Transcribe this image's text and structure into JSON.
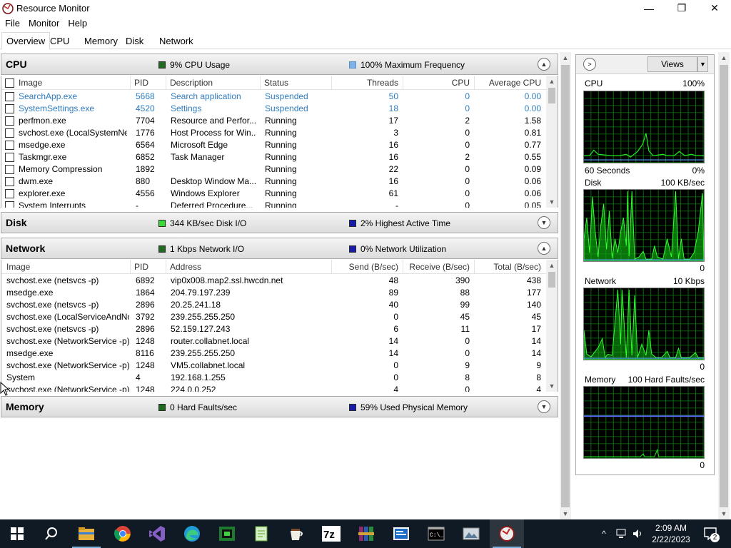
{
  "window": {
    "title": "Resource Monitor",
    "controls": [
      "—",
      "❐",
      "✕"
    ]
  },
  "menu": [
    "File",
    "Monitor",
    "Help"
  ],
  "tabs": [
    "Overview",
    "CPU",
    "Memory",
    "Disk",
    "Network"
  ],
  "cpu": {
    "title": "CPU",
    "usage_color": "#1d6d1d",
    "usage": "9% CPU Usage",
    "freq_color": "#7fb2ea",
    "freq": "100% Maximum Frequency",
    "columns": [
      "Image",
      "PID",
      "Description",
      "Status",
      "Threads",
      "CPU",
      "Average CPU"
    ],
    "rows": [
      {
        "image": "SearchApp.exe",
        "pid": "5668",
        "desc": "Search application",
        "status": "Suspended",
        "threads": "50",
        "cpu": "0",
        "avg": "0.00",
        "suspended": true
      },
      {
        "image": "SystemSettings.exe",
        "pid": "4520",
        "desc": "Settings",
        "status": "Suspended",
        "threads": "18",
        "cpu": "0",
        "avg": "0.00",
        "suspended": true
      },
      {
        "image": "perfmon.exe",
        "pid": "7704",
        "desc": "Resource and Perfor...",
        "status": "Running",
        "threads": "17",
        "cpu": "2",
        "avg": "1.58"
      },
      {
        "image": "svchost.exe (LocalSystemNet...",
        "pid": "1776",
        "desc": "Host Process for Win...",
        "status": "Running",
        "threads": "3",
        "cpu": "0",
        "avg": "0.81"
      },
      {
        "image": "msedge.exe",
        "pid": "6564",
        "desc": "Microsoft Edge",
        "status": "Running",
        "threads": "16",
        "cpu": "0",
        "avg": "0.77"
      },
      {
        "image": "Taskmgr.exe",
        "pid": "6852",
        "desc": "Task Manager",
        "status": "Running",
        "threads": "16",
        "cpu": "2",
        "avg": "0.55"
      },
      {
        "image": "Memory Compression",
        "pid": "1892",
        "desc": "",
        "status": "Running",
        "threads": "22",
        "cpu": "0",
        "avg": "0.09"
      },
      {
        "image": "dwm.exe",
        "pid": "880",
        "desc": "Desktop Window Ma...",
        "status": "Running",
        "threads": "16",
        "cpu": "0",
        "avg": "0.06"
      },
      {
        "image": "explorer.exe",
        "pid": "4556",
        "desc": "Windows Explorer",
        "status": "Running",
        "threads": "61",
        "cpu": "0",
        "avg": "0.06"
      },
      {
        "image": "System Interrupts",
        "pid": "-",
        "desc": "Deferred Procedure...",
        "status": "Running",
        "threads": "-",
        "cpu": "0",
        "avg": "0.05"
      }
    ]
  },
  "disk": {
    "title": "Disk",
    "io_color": "#33dd33",
    "io": "344 KB/sec Disk I/O",
    "active_color": "#1a1aa8",
    "active": "2% Highest Active Time"
  },
  "network": {
    "title": "Network",
    "io_color": "#1d6d1d",
    "io": "1 Kbps Network I/O",
    "util_color": "#1a1aa8",
    "util": "0% Network Utilization",
    "columns": [
      "Image",
      "PID",
      "Address",
      "Send (B/sec)",
      "Receive (B/sec)",
      "Total (B/sec)"
    ],
    "rows": [
      {
        "image": "svchost.exe (netsvcs -p)",
        "pid": "6892",
        "address": "vip0x008.map2.ssl.hwcdn.net",
        "send": "48",
        "recv": "390",
        "total": "438"
      },
      {
        "image": "msedge.exe",
        "pid": "1864",
        "address": "204.79.197.239",
        "send": "89",
        "recv": "88",
        "total": "177"
      },
      {
        "image": "svchost.exe (netsvcs -p)",
        "pid": "2896",
        "address": "20.25.241.18",
        "send": "40",
        "recv": "99",
        "total": "140"
      },
      {
        "image": "svchost.exe (LocalServiceAndNo...",
        "pid": "3792",
        "address": "239.255.255.250",
        "send": "0",
        "recv": "45",
        "total": "45"
      },
      {
        "image": "svchost.exe (netsvcs -p)",
        "pid": "2896",
        "address": "52.159.127.243",
        "send": "6",
        "recv": "11",
        "total": "17"
      },
      {
        "image": "svchost.exe (NetworkService -p)",
        "pid": "1248",
        "address": "router.collabnet.local",
        "send": "14",
        "recv": "0",
        "total": "14"
      },
      {
        "image": "msedge.exe",
        "pid": "8116",
        "address": "239.255.255.250",
        "send": "14",
        "recv": "0",
        "total": "14"
      },
      {
        "image": "svchost.exe (NetworkService -p)",
        "pid": "1248",
        "address": "VM5.collabnet.local",
        "send": "0",
        "recv": "9",
        "total": "9"
      },
      {
        "image": "System",
        "pid": "4",
        "address": "192.168.1.255",
        "send": "0",
        "recv": "8",
        "total": "8"
      },
      {
        "image": "svchost.exe (NetworkService -p)",
        "pid": "1248",
        "address": "224.0.0.252",
        "send": "4",
        "recv": "0",
        "total": "4"
      }
    ]
  },
  "memory": {
    "title": "Memory",
    "faults_color": "#1d6d1d",
    "faults": "0 Hard Faults/sec",
    "used_color": "#1a1aa8",
    "used": "59% Used Physical Memory"
  },
  "right_panel": {
    "views_label": "Views",
    "graphs": [
      {
        "name": "CPU",
        "max": "100%",
        "footer_left": "60 Seconds",
        "footer_right": "0%"
      },
      {
        "name": "Disk",
        "max": "100 KB/sec",
        "footer_left": "",
        "footer_right": "0"
      },
      {
        "name": "Network",
        "max": "10 Kbps",
        "footer_left": "",
        "footer_right": "0"
      },
      {
        "name": "Memory",
        "max": "100 Hard Faults/sec",
        "footer_left": "",
        "footer_right": "0"
      }
    ]
  },
  "taskbar": {
    "apps": [
      "start-icon",
      "search-icon",
      "file-explorer-icon",
      "chrome-icon",
      "visual-studio-icon",
      "edge-icon",
      "green-app-icon",
      "notepad-plus-icon",
      "coffee-icon",
      "7zip-icon",
      "winrar-icon",
      "blue-app-icon",
      "terminal-icon",
      "photo-icon",
      "resource-monitor-icon"
    ],
    "time": "2:09 AM",
    "date": "2/22/2023",
    "notification_count": "2"
  }
}
